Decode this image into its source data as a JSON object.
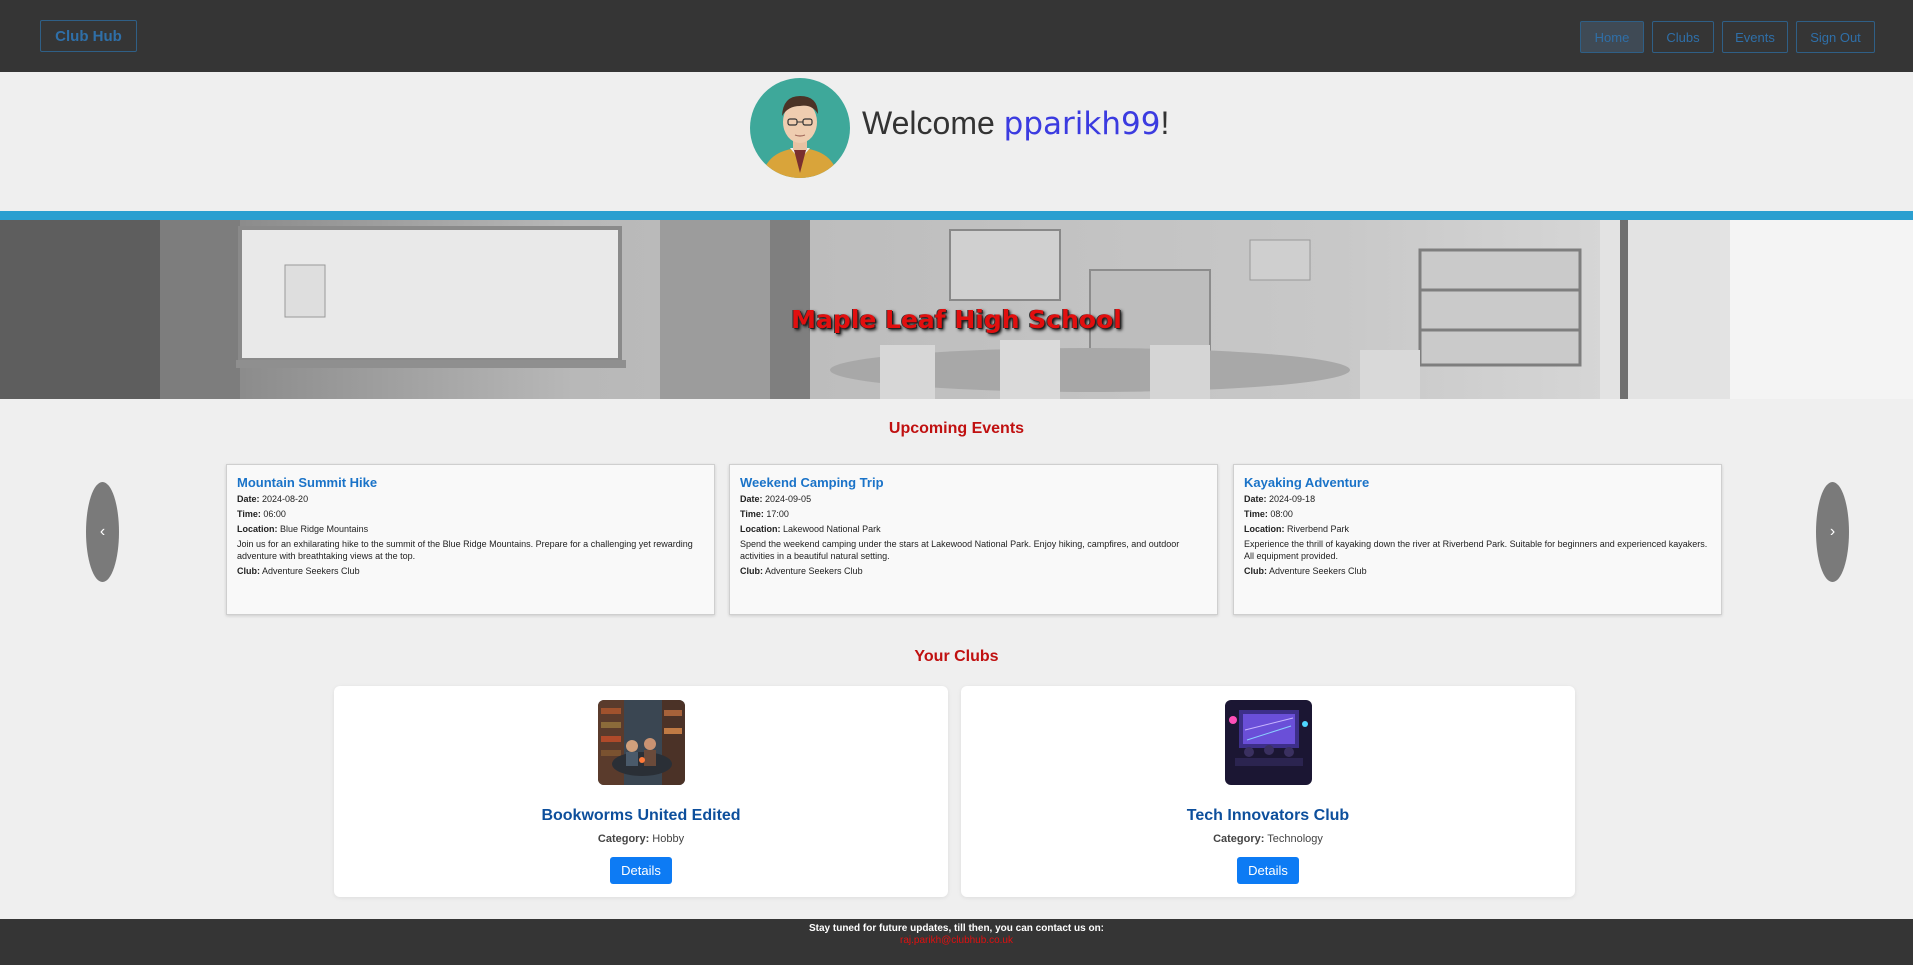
{
  "nav": {
    "brand": "Club Hub",
    "items": [
      {
        "label": "Home"
      },
      {
        "label": "Clubs"
      },
      {
        "label": "Events"
      },
      {
        "label": "Sign Out"
      }
    ]
  },
  "welcome": {
    "greeting": "Welcome ",
    "username": "pparikh99",
    "suffix": "!"
  },
  "banner": {
    "school_name": "Maple Leaf High School"
  },
  "events_section": {
    "title": "Upcoming Events",
    "prev_glyph": "‹",
    "next_glyph": "›",
    "labels": {
      "date": "Date:",
      "time": "Time:",
      "location": "Location:",
      "club": "Club:"
    },
    "events": [
      {
        "title": "Mountain Summit Hike",
        "date": "2024-08-20",
        "time": "06:00",
        "location": "Blue Ridge Mountains",
        "description": "Join us for an exhilarating hike to the summit of the Blue Ridge Mountains. Prepare for a challenging yet rewarding adventure with breathtaking views at the top.",
        "club": "Adventure Seekers Club"
      },
      {
        "title": "Weekend Camping Trip",
        "date": "2024-09-05",
        "time": "17:00",
        "location": "Lakewood National Park",
        "description": "Spend the weekend camping under the stars at Lakewood National Park. Enjoy hiking, campfires, and outdoor activities in a beautiful natural setting.",
        "club": "Adventure Seekers Club"
      },
      {
        "title": "Kayaking Adventure",
        "date": "2024-09-18",
        "time": "08:00",
        "location": "Riverbend Park",
        "description": "Experience the thrill of kayaking down the river at Riverbend Park. Suitable for beginners and experienced kayakers. All equipment provided.",
        "club": "Adventure Seekers Club"
      }
    ]
  },
  "clubs_section": {
    "title": "Your Clubs",
    "category_label": "Category:",
    "clubs": [
      {
        "name": "Bookworms United Edited",
        "category": "Hobby",
        "button": "Details"
      },
      {
        "name": "Tech Innovators Club",
        "category": "Technology",
        "button": "Details"
      }
    ]
  },
  "footer": {
    "text": "Stay tuned for future updates, till then, you can contact us on:",
    "email": "raj.parikh@clubhub.co.uk"
  },
  "colors": {
    "nav_bg": "#353535",
    "accent_blue": "#2b9fd0",
    "section_title": "#c01010",
    "event_title": "#1a73c8",
    "club_name": "#0d4f9c",
    "button_bg": "#0d7bf4"
  }
}
